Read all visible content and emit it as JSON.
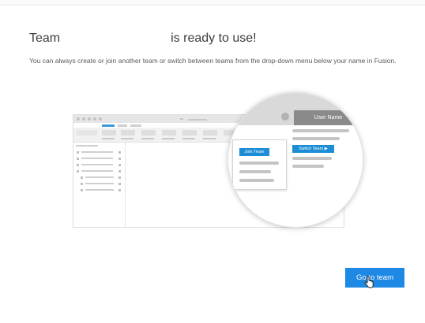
{
  "heading": {
    "prefix": "Team",
    "suffix": "is ready to use!"
  },
  "description": "You can always create or join another team or switch between teams from the drop-down menu below your name in Fusion.",
  "illustration": {
    "user_name_label": "User Name",
    "join_team_label": "Join Team",
    "switch_team_label": "Switch Team ▶"
  },
  "actions": {
    "go_to_team_label": "Go to team"
  },
  "colors": {
    "accent": "#1e88e5",
    "user_header": "#8a8a8a"
  }
}
